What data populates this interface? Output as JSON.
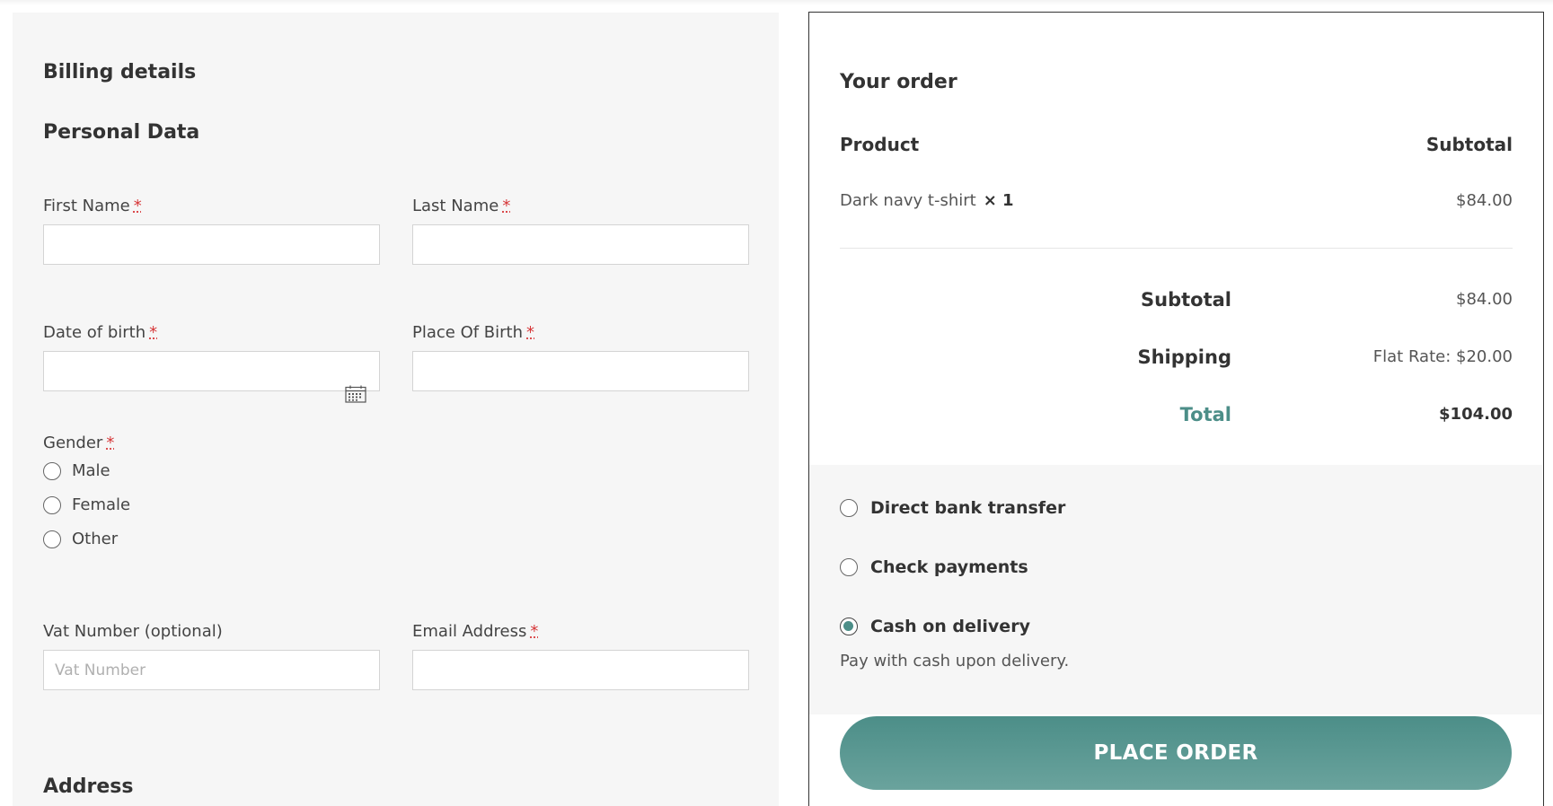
{
  "billing": {
    "title": "Billing details",
    "personal_heading": "Personal Data",
    "required_mark": "*",
    "first_name_label": "First Name",
    "last_name_label": "Last Name",
    "dob_label": "Date of birth",
    "pob_label": "Place Of Birth",
    "gender_label": "Gender",
    "gender_options": [
      "Male",
      "Female",
      "Other"
    ],
    "vat_label": "Vat Number (optional)",
    "vat_placeholder": "Vat Number",
    "email_label": "Email Address",
    "address_heading": "Address"
  },
  "order": {
    "title": "Your order",
    "product_header": "Product",
    "subtotal_header": "Subtotal",
    "item_name": "Dark navy t-shirt",
    "item_qty": "× 1",
    "item_price": "$84.00",
    "subtotal_label": "Subtotal",
    "subtotal_value": "$84.00",
    "shipping_label": "Shipping",
    "shipping_value": "Flat Rate: $20.00",
    "total_label": "Total",
    "total_value": "$104.00"
  },
  "payment": {
    "methods": [
      "Direct bank transfer",
      "Check payments",
      "Cash on delivery"
    ],
    "selected": "Cash on delivery",
    "description": "Pay with cash upon delivery.",
    "place_order_label": "PLACE ORDER"
  },
  "colors": {
    "accent": "#4c8e88",
    "panel_bg": "#f6f6f6",
    "required": "#d63638"
  },
  "icons": {
    "date_field": "calendar-icon"
  }
}
